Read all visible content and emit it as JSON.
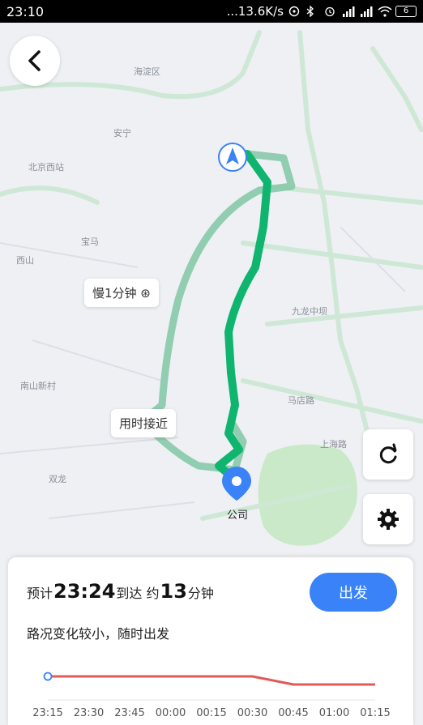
{
  "status_bar": {
    "time": "23:10",
    "net_speed": "...13.6K/s",
    "battery": "6"
  },
  "map": {
    "labels": [
      "海淀区",
      "安宁",
      "北京西站",
      "九龙中坝",
      "上海路",
      "西山",
      "马店路",
      "宝马",
      "南山新村",
      "双龙"
    ],
    "route_tags": [
      {
        "text": "慢1分钟 ⊛"
      },
      {
        "text": "用时接近"
      }
    ],
    "destination": "公司",
    "colors": {
      "main_route": "#0fb56f",
      "alt_route": "#86c9a9",
      "road": "#cfe8d6",
      "park": "#c9e9c8"
    }
  },
  "panel": {
    "eta_prefix": "预计",
    "eta_time": "23:24",
    "eta_mid": "到达 约",
    "eta_minutes": "13",
    "eta_suffix": "分钟",
    "go_label": "出发",
    "status": "路况变化较小，随时出发",
    "ticks": [
      "23:15",
      "23:30",
      "23:45",
      "00:00",
      "00:15",
      "00:30",
      "00:45",
      "01:00",
      "01:15"
    ],
    "trend_minutes": [
      14,
      14,
      14,
      14,
      14,
      14,
      13,
      13,
      13
    ]
  }
}
